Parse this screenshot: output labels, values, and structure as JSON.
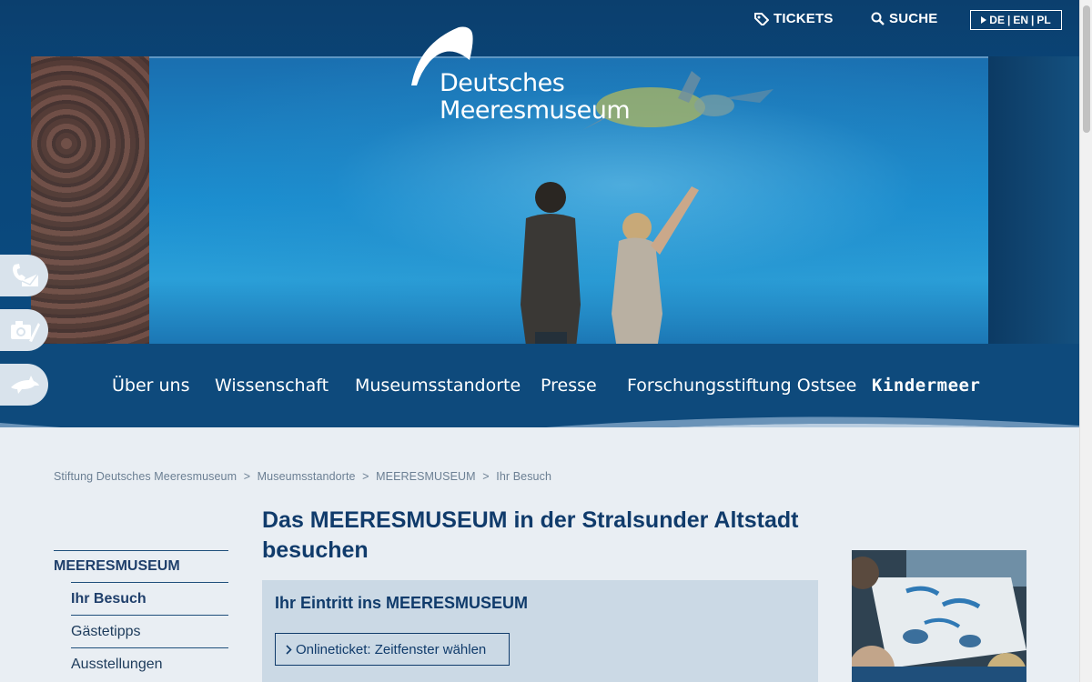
{
  "top": {
    "tickets_label": "TICKETS",
    "search_label": "SUCHE",
    "languages": [
      "DE",
      "|",
      "EN",
      "|",
      "PL"
    ]
  },
  "logo": {
    "line1": "Deutsches",
    "line2": "Meeresmuseum"
  },
  "nav": {
    "items": [
      "Über uns",
      "Wissenschaft",
      "Museumsstandorte",
      "Presse",
      "Forschungsstiftung Ostsee",
      "Kindermeer"
    ]
  },
  "side_tabs": [
    "contact-icon",
    "camera-icon",
    "dolphin-icon"
  ],
  "breadcrumb": [
    "Stiftung Deutsches Meeresmuseum",
    ">",
    "Museumsstandorte",
    ">",
    "MEERESMUSEUM",
    ">",
    "Ihr Besuch"
  ],
  "subnav": {
    "section": "MEERESMUSEUM",
    "items": [
      "Ihr Besuch",
      "Gästetipps",
      "Ausstellungen"
    ]
  },
  "content": {
    "title": "Das MEERESMUSEUM in der Stralsunder Altstadt besuchen",
    "box_title": "Ihr Eintritt ins MEERESMUSEUM",
    "ticket_button": "Onlineticket: Zeitfenster wählen"
  },
  "colors": {
    "nav_bg": "#0e4a7c",
    "heading": "#103b6b",
    "page_bg": "#e9eef3",
    "box_bg": "#cbd9e5"
  }
}
